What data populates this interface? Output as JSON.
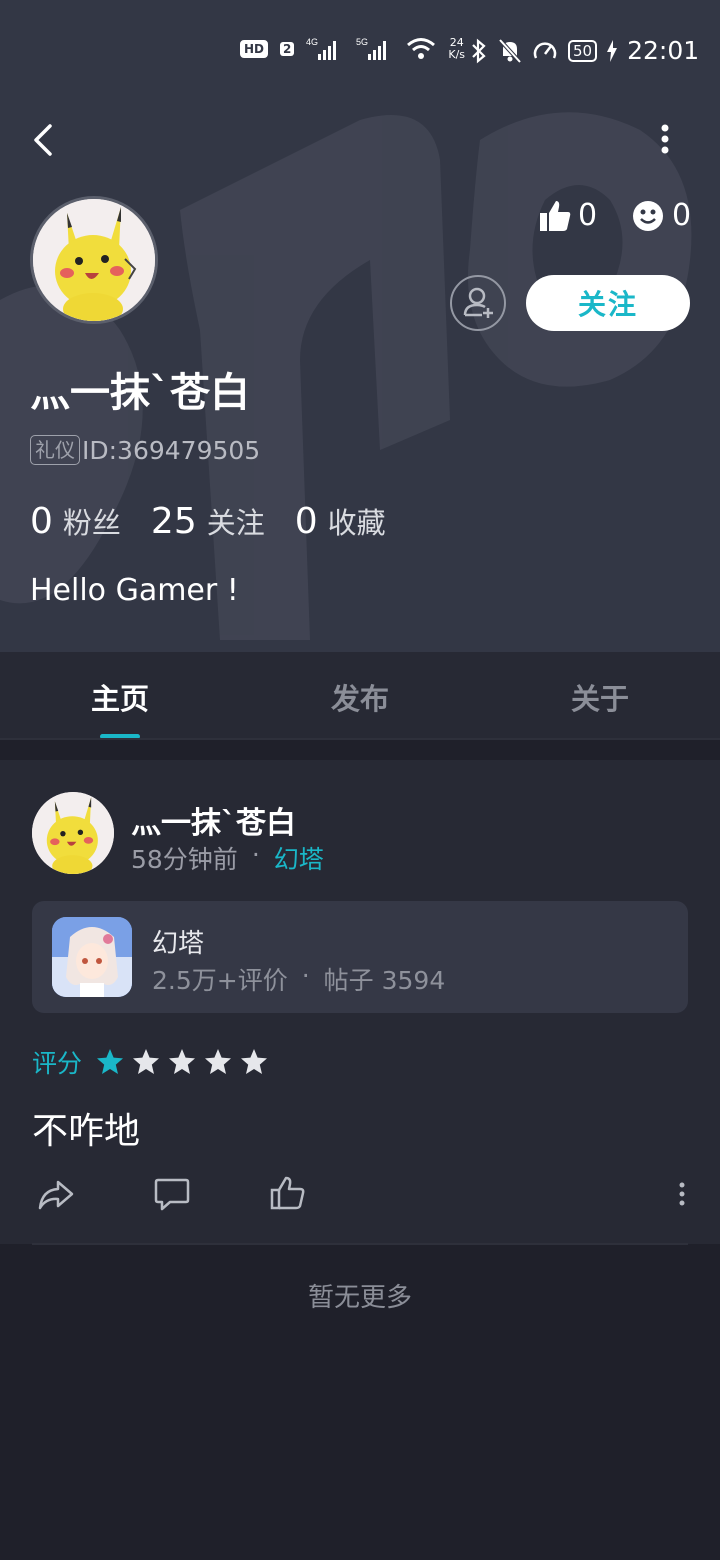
{
  "status_bar": {
    "hd": "HD",
    "sim": "2",
    "net1": "4G",
    "net2": "5G",
    "speed_value": "24",
    "speed_unit": "K/s",
    "battery": "50",
    "time": "22:01"
  },
  "profile": {
    "username": "灬一抹`苍白",
    "tag": "礼仪",
    "id": "ID:369479505",
    "likes": "0",
    "smiles": "0",
    "follow_label": "关注",
    "stats": [
      {
        "num": "0",
        "label": "粉丝"
      },
      {
        "num": "25",
        "label": "关注"
      },
      {
        "num": "0",
        "label": "收藏"
      }
    ],
    "bio": "Hello Gamer !"
  },
  "tabs": [
    {
      "label": "主页",
      "active": true
    },
    {
      "label": "发布",
      "active": false
    },
    {
      "label": "关于",
      "active": false
    }
  ],
  "post": {
    "author": "灬一抹`苍白",
    "time_ago": "58分钟前",
    "dot": "·",
    "game_link": "幻塔",
    "game_card": {
      "name": "幻塔",
      "reviews": "2.5万+评价",
      "dot": "·",
      "posts": "帖子 3594"
    },
    "rating_label": "评分",
    "rating_stars": 1,
    "rating_max": 5,
    "text": "不咋地"
  },
  "footer": {
    "no_more": "暂无更多"
  },
  "colors": {
    "accent": "#1ab7c8",
    "header_bg": "#333745",
    "page_bg": "#1f202a",
    "card_bg": "#272934"
  },
  "icons": [
    "back-icon",
    "more-vertical-icon",
    "thumbs-up-icon",
    "smile-icon",
    "add-friend-icon",
    "share-icon",
    "comment-icon",
    "like-icon",
    "star-icon"
  ]
}
